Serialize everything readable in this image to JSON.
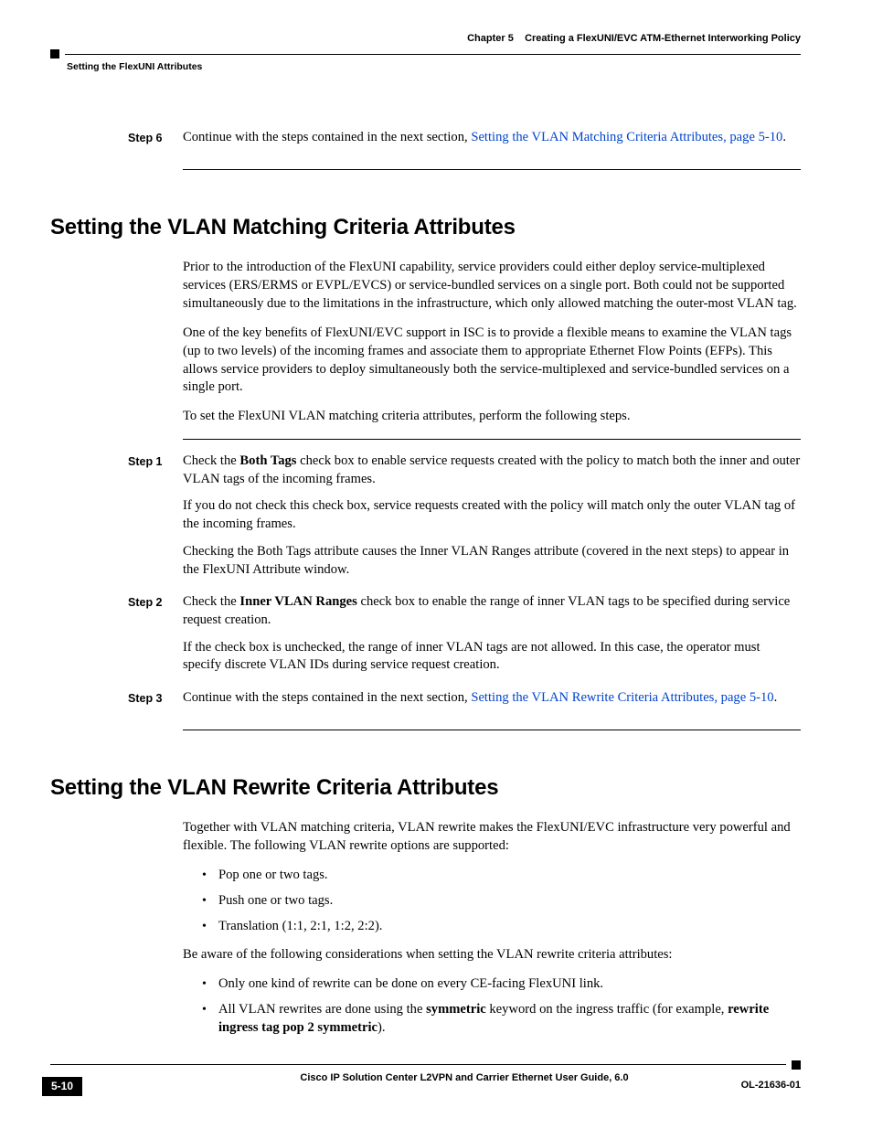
{
  "header": {
    "chapter_label": "Chapter 5",
    "chapter_title": "Creating a FlexUNI/EVC ATM-Ethernet Interworking Policy",
    "section_breadcrumb": "Setting the FlexUNI Attributes"
  },
  "block1": {
    "step6_label": "Step 6",
    "step6_text_1": "Continue with the steps contained in the next section, ",
    "step6_link": "Setting the VLAN Matching Criteria Attributes, page 5-10",
    "step6_text_2": "."
  },
  "section_match": {
    "title": "Setting the VLAN Matching Criteria Attributes",
    "intro_p1": "Prior to the introduction of the FlexUNI capability, service providers could either deploy service-multiplexed services (ERS/ERMS or EVPL/EVCS) or service-bundled services on a single port. Both could not be supported simultaneously due to the limitations in the infrastructure, which only allowed matching the outer-most VLAN tag.",
    "intro_p2": "One of the key benefits of FlexUNI/EVC support in ISC is to provide a flexible means to examine the VLAN tags (up to two levels) of the incoming frames and associate them to appropriate Ethernet Flow Points (EFPs). This allows service providers to deploy simultaneously both the service-multiplexed and service-bundled services on a single port.",
    "intro_p3": "To set the FlexUNI VLAN matching criteria attributes, perform the following steps.",
    "step1_label": "Step 1",
    "step1_p1_a": "Check the ",
    "step1_p1_bold": "Both Tags",
    "step1_p1_b": " check box to enable service requests created with the policy to match both the inner and outer VLAN tags of the incoming frames.",
    "step1_p2": "If you do not check this check box, service requests created with the policy will match only the outer VLAN tag of the incoming frames.",
    "step1_p3": "Checking the Both Tags attribute causes the Inner VLAN Ranges attribute (covered in the next steps) to appear in the FlexUNI Attribute window.",
    "step2_label": "Step 2",
    "step2_p1_a": "Check the ",
    "step2_p1_bold": "Inner VLAN Ranges",
    "step2_p1_b": " check box to enable the range of inner VLAN tags to be specified during service request creation.",
    "step2_p2": "If the check box is unchecked, the range of inner VLAN tags are not allowed. In this case, the operator must specify discrete VLAN IDs during service request creation.",
    "step3_label": "Step 3",
    "step3_p1_a": "Continue with the steps contained in the next section, ",
    "step3_link": "Setting the VLAN Rewrite Criteria Attributes, page 5-10",
    "step3_p1_b": "."
  },
  "section_rewrite": {
    "title": "Setting the VLAN Rewrite Criteria Attributes",
    "p1": "Together with VLAN matching criteria, VLAN rewrite makes the FlexUNI/EVC infrastructure very powerful and flexible. The following VLAN rewrite options are supported:",
    "bullets1": [
      "Pop one or two tags.",
      "Push one or two tags.",
      "Translation (1:1, 2:1, 1:2, 2:2)."
    ],
    "p2": "Be aware of the following considerations when setting the VLAN rewrite criteria attributes:",
    "bullets2_item1": "Only one kind of rewrite can be done on every CE-facing FlexUNI link.",
    "bullets2_item2_a": "All VLAN rewrites are done using the ",
    "bullets2_item2_bold1": "symmetric",
    "bullets2_item2_b": " keyword on the ingress traffic (for example, ",
    "bullets2_item2_bold2": "rewrite ingress tag pop 2 symmetric",
    "bullets2_item2_c": ")."
  },
  "footer": {
    "guide_title": "Cisco IP Solution Center L2VPN and Carrier Ethernet User Guide, 6.0",
    "page_number": "5-10",
    "doc_id": "OL-21636-01"
  }
}
